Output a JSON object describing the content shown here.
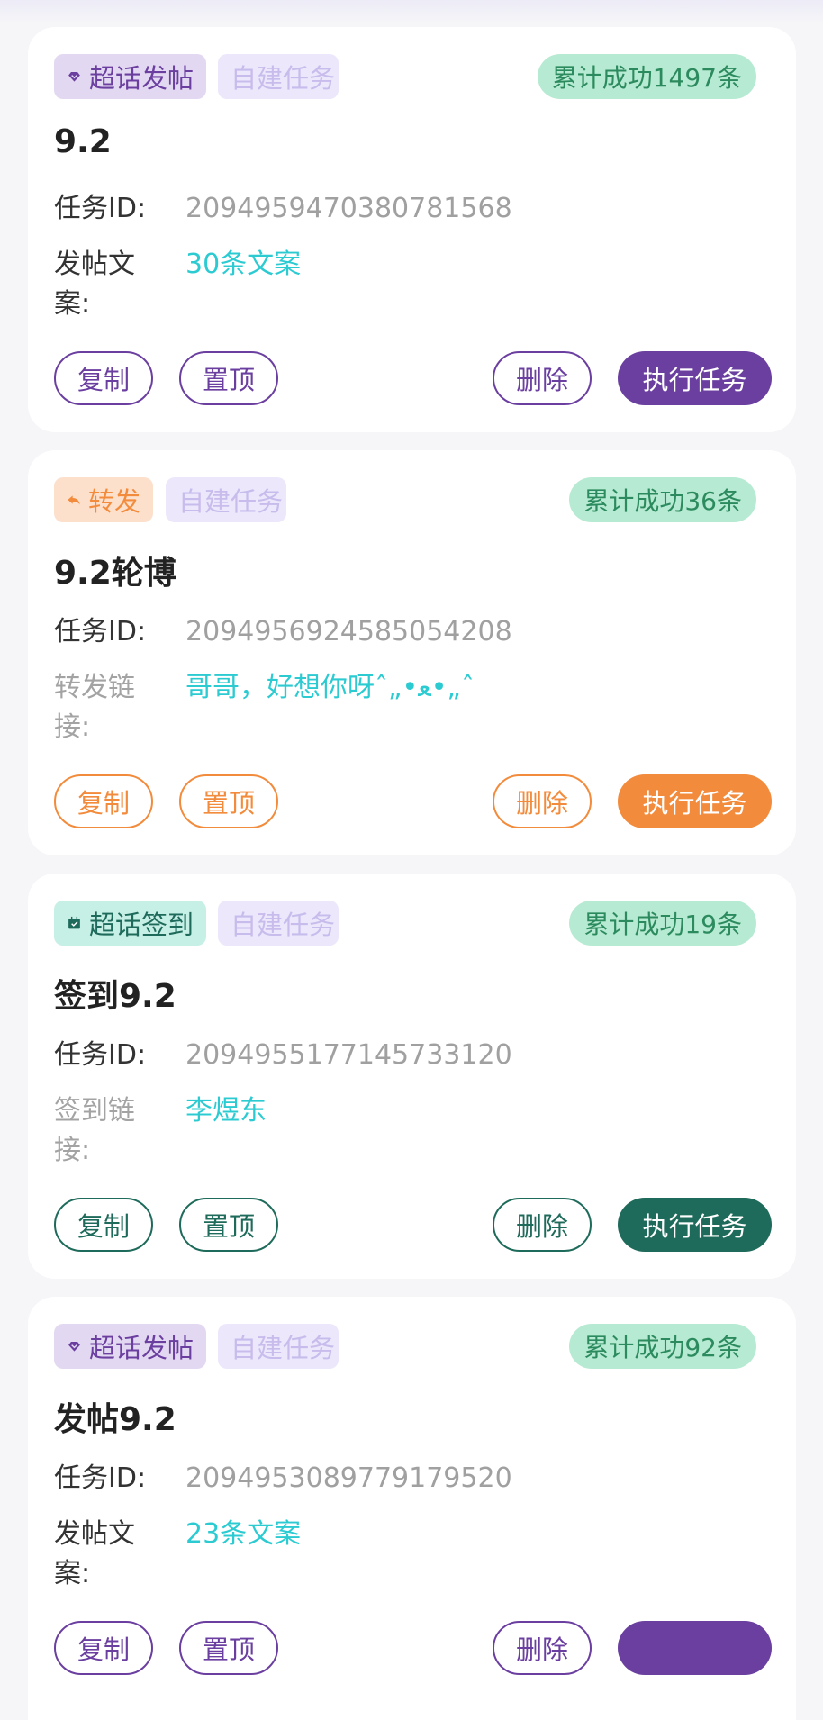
{
  "common": {
    "self_built": "自建任务",
    "task_id_label": "任务ID:",
    "copy": "复制",
    "pin": "置顶",
    "delete": "删除",
    "execute": "执行任务"
  },
  "cards": [
    {
      "type": "超话发帖",
      "type_icon": "diamond-icon",
      "counter": "累计成功1497条",
      "title": "9.2",
      "task_id": "2094959470380781568",
      "field_label": "发帖文案:",
      "field_value": "30条文案",
      "theme": "#6b3fa0"
    },
    {
      "type": "转发",
      "type_icon": "reply-arrow-icon",
      "counter": "累计成功36条",
      "title": "9.2轮博",
      "task_id": "2094956924585054208",
      "field_label": "转发链接:",
      "field_value": "哥哥，好想你呀ˆ„•ﻌ•„ˆ",
      "theme": "#f28b3c"
    },
    {
      "type": "超话签到",
      "type_icon": "calendar-check-icon",
      "counter": "累计成功19条",
      "title": "签到9.2",
      "task_id": "2094955177145733120",
      "field_label": "签到链接:",
      "field_value": "李煜东",
      "theme": "#1f6b5b"
    },
    {
      "type": "超话发帖",
      "type_icon": "diamond-icon",
      "counter": "累计成功92条",
      "title": "发帖9.2",
      "task_id": "2094953089779179520",
      "field_label": "发帖文案:",
      "field_value": "23条文案",
      "theme": "#6b3fa0"
    }
  ]
}
